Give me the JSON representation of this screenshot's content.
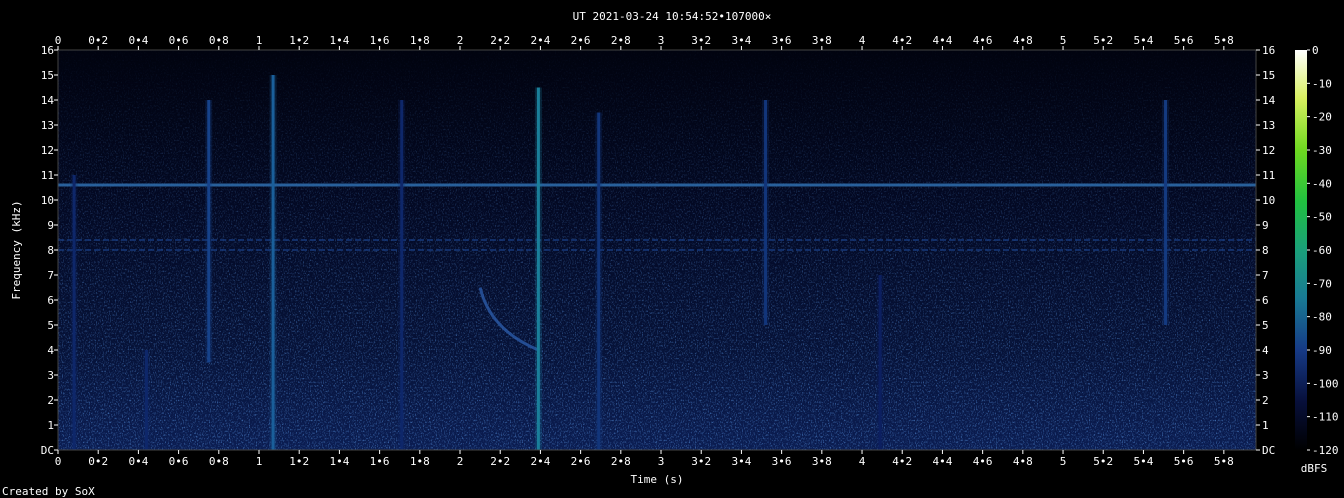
{
  "chart_data": {
    "type": "heatmap",
    "title": "UT 2021-03-24 10:54:52•107000×",
    "xlabel": "Time (s)",
    "ylabel": "Frequency (kHz)",
    "xlim": [
      0,
      5.96
    ],
    "ylim": [
      0,
      16
    ],
    "x_ticks": [
      "0",
      "0•2",
      "0•4",
      "0•6",
      "0•8",
      "1",
      "1•2",
      "1•4",
      "1•6",
      "1•8",
      "2",
      "2•2",
      "2•4",
      "2•6",
      "2•8",
      "3",
      "3•2",
      "3•4",
      "3•6",
      "3•8",
      "4",
      "4•2",
      "4•4",
      "4•6",
      "4•8",
      "5",
      "5•2",
      "5•4",
      "5•6",
      "5•8"
    ],
    "y_ticks": [
      "DC",
      "1",
      "2",
      "3",
      "4",
      "5",
      "6",
      "7",
      "8",
      "9",
      "10",
      "11",
      "12",
      "13",
      "14",
      "15",
      "16"
    ],
    "colorbar": {
      "label": "dBFS",
      "ticks": [
        "0",
        "-10",
        "-20",
        "-30",
        "-40",
        "-50",
        "-60",
        "-70",
        "-80",
        "-90",
        "-100",
        "-110",
        "-120"
      ],
      "range": [
        -120,
        0
      ]
    },
    "features": {
      "horizontal_lines_khz": [
        10.6,
        8.4,
        8.0
      ],
      "impulses": [
        {
          "t": 0.08,
          "fmax": 11.0,
          "level": -95
        },
        {
          "t": 0.44,
          "fmax": 4.0,
          "level": -95
        },
        {
          "t": 0.75,
          "fmax": 14.0,
          "level": -85,
          "fmin": 3.5
        },
        {
          "t": 1.07,
          "fmax": 15.0,
          "level": -75
        },
        {
          "t": 1.71,
          "fmax": 14.0,
          "level": -95
        },
        {
          "t": 2.39,
          "fmax": 14.5,
          "level": -65
        },
        {
          "t": 2.69,
          "fmax": 13.5,
          "level": -90
        },
        {
          "t": 3.52,
          "fmax": 14.0,
          "level": -90,
          "fmin": 5.0
        },
        {
          "t": 4.09,
          "fmax": 7.0,
          "level": -98
        },
        {
          "t": 5.51,
          "fmax": 14.0,
          "level": -88,
          "fmin": 5.0
        }
      ],
      "sweep": {
        "t_start": 2.1,
        "f_start": 6.5,
        "t_end": 2.39,
        "f_end": 4.0
      }
    },
    "palette": [
      "#000000",
      "#0a1a5a",
      "#1a4f9a",
      "#1a8f9a",
      "#22c050",
      "#90e020",
      "#ffffff"
    ]
  },
  "footer": {
    "credit": "Created by SoX"
  }
}
